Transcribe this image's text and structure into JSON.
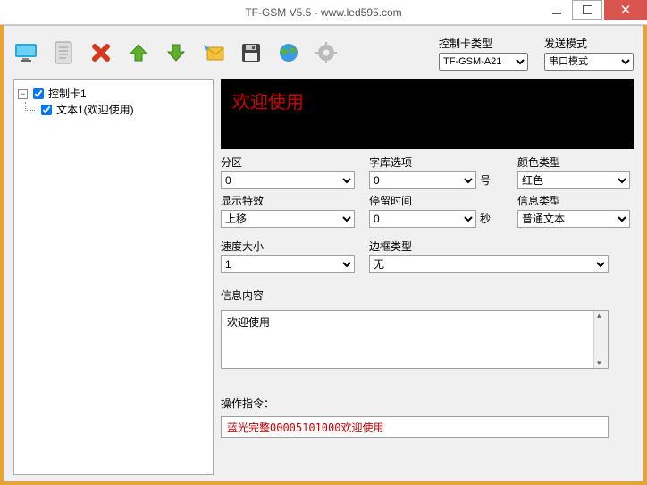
{
  "window": {
    "title": "TF-GSM V5.5 - www.led595.com"
  },
  "toolbar": {
    "cardType": {
      "label": "控制卡类型",
      "value": "TF-GSM-A21"
    },
    "sendMode": {
      "label": "发送模式",
      "value": "串口模式"
    }
  },
  "tree": {
    "root": {
      "label": "控制卡1",
      "checked": true
    },
    "child": {
      "label": "文本1(欢迎使用)",
      "checked": true
    }
  },
  "preview": {
    "text": "欢迎使用"
  },
  "form": {
    "partition": {
      "label": "分区",
      "value": "0"
    },
    "fontOption": {
      "label": "字库选项",
      "value": "0",
      "suffix": "号"
    },
    "colorType": {
      "label": "颜色类型",
      "value": "红色"
    },
    "displayEffect": {
      "label": "显示特效",
      "value": "上移"
    },
    "stayTime": {
      "label": "停留时间",
      "value": "0",
      "suffix": "秒"
    },
    "infoType": {
      "label": "信息类型",
      "value": "普通文本"
    },
    "speed": {
      "label": "速度大小",
      "value": "1"
    },
    "borderType": {
      "label": "边框类型",
      "value": "无"
    }
  },
  "content": {
    "label": "信息内容",
    "value": "欢迎使用"
  },
  "operation": {
    "label": "操作指令：",
    "value": "蓝光完整00005101000欢迎使用"
  }
}
